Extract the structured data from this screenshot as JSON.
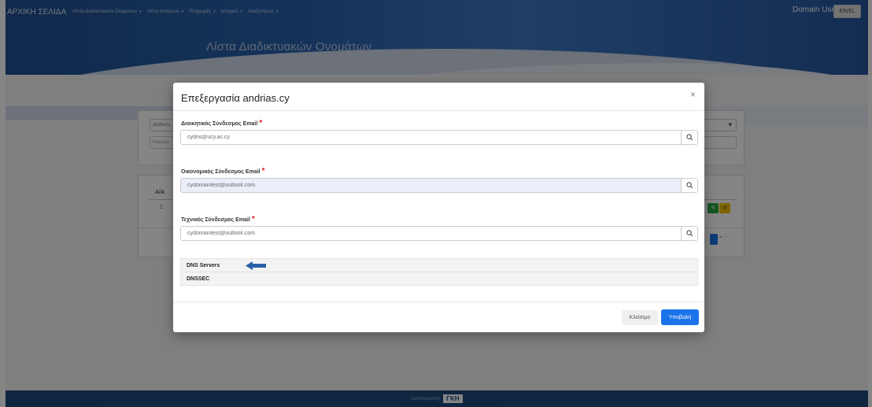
{
  "nav": {
    "brand": "ΑΡΧΙΚΗ ΣΕΛΙΔΑ",
    "items": [
      {
        "label": "Λίστα Διαδικτυακών Ονομάτων"
      },
      {
        "label": "Λίστα Αιτήσεων"
      },
      {
        "label": "Πληρωμές"
      },
      {
        "label": "Ιστορικό"
      },
      {
        "label": "Αναζητήσεις"
      }
    ],
    "caret": "▾",
    "user": "Domain User",
    "language": "EN/EL"
  },
  "page": {
    "title": "Λίστα Διαδικτυακών Ονομάτων",
    "filter_field_1": "Διαδικτυ",
    "filter_field_2": "Ημερομ",
    "table_header": "A/A",
    "row_number": "1",
    "pager_more": "» ⋯"
  },
  "footer": {
    "developed_by": "Developed by",
    "logo": "ΓΚΗ"
  },
  "modal": {
    "title": "Επεξεργασία andrias.cy",
    "close_symbol": "×",
    "required_mark": "*",
    "fields": [
      {
        "label": "Διοικητικός Σύνδεσμος Email",
        "value": "cydns@ucy.ac.cy"
      },
      {
        "label": "Οικονομικός Σύνδεσμος Email",
        "value": "cydomaintest@outlook.com"
      },
      {
        "label": "Τεχνικός Σύνδεσμος Email",
        "value": "cydomaintest@outlook.com"
      }
    ],
    "accordion": [
      "DNS Servers",
      "DNSSEC"
    ],
    "close_button": "Κλείσιμο",
    "submit_button": "Υποβολή"
  },
  "colors": {
    "primary": "#1a73e8",
    "required": "#e31b23",
    "navbar": "#1f4f92",
    "footer": "#1d4a7c"
  }
}
